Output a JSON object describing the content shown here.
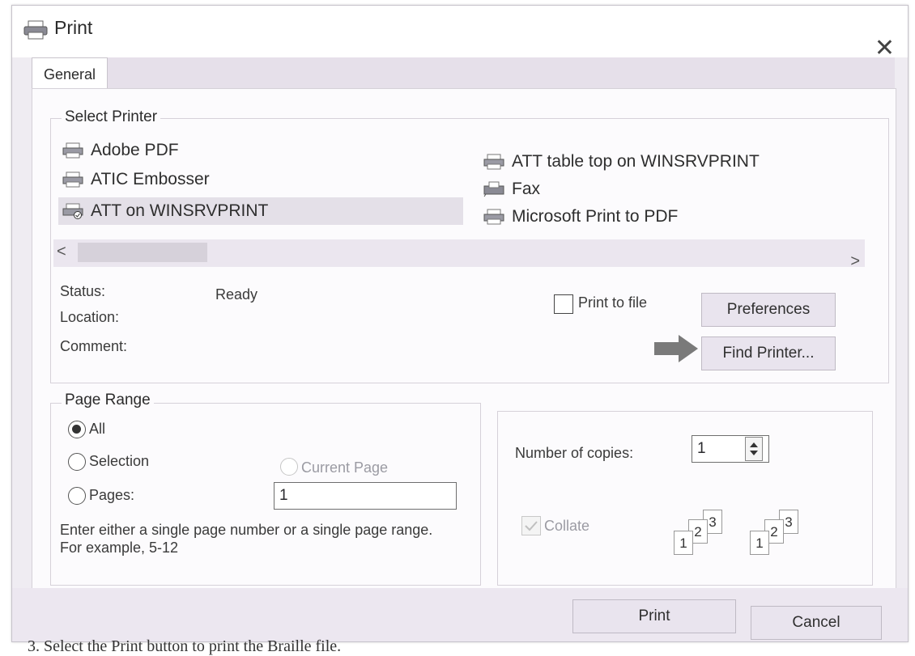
{
  "window": {
    "title": "Print",
    "close_glyph": "✕"
  },
  "tabs": [
    {
      "label": "General",
      "active": true
    }
  ],
  "select_printer": {
    "legend": "Select Printer",
    "printers": [
      {
        "name": "Adobe PDF",
        "icon": "printer-icon",
        "selected": false
      },
      {
        "name": "ATIC Embosser",
        "icon": "printer-icon",
        "selected": false
      },
      {
        "name": "ATT on WINSRVPRINT",
        "icon": "network-printer-icon",
        "selected": true
      },
      {
        "name": "ATT table top on WINSRVPRINT",
        "icon": "network-printer-icon",
        "selected": false
      },
      {
        "name": "Fax",
        "icon": "fax-icon",
        "selected": false
      },
      {
        "name": "Microsoft Print to PDF",
        "icon": "printer-icon",
        "selected": false
      }
    ],
    "scroll_left": "<",
    "scroll_right": ">",
    "status_label": "Status:",
    "status_value": "Ready",
    "location_label": "Location:",
    "comment_label": "Comment:",
    "print_to_file_label": "Print to file",
    "print_to_file_checked": false,
    "preferences_label": "Preferences",
    "find_printer_label": "Find Printer..."
  },
  "page_range": {
    "legend": "Page Range",
    "all_label": "All",
    "selection_label": "Selection",
    "current_page_label": "Current Page",
    "pages_label": "Pages:",
    "pages_value": "1",
    "hint": "Enter either a single page number or a single page range.  For example, 5-12",
    "selected": "All"
  },
  "copies": {
    "label": "Number of copies:",
    "value": "1",
    "collate_label": "Collate",
    "collate_checked": true,
    "collate_enabled": false,
    "stack_pages": [
      "1",
      "2",
      "3"
    ]
  },
  "footer": {
    "print_label": "Print",
    "cancel_label": "Cancel"
  },
  "caption": "3.   Select the Print button to print the Braille file."
}
